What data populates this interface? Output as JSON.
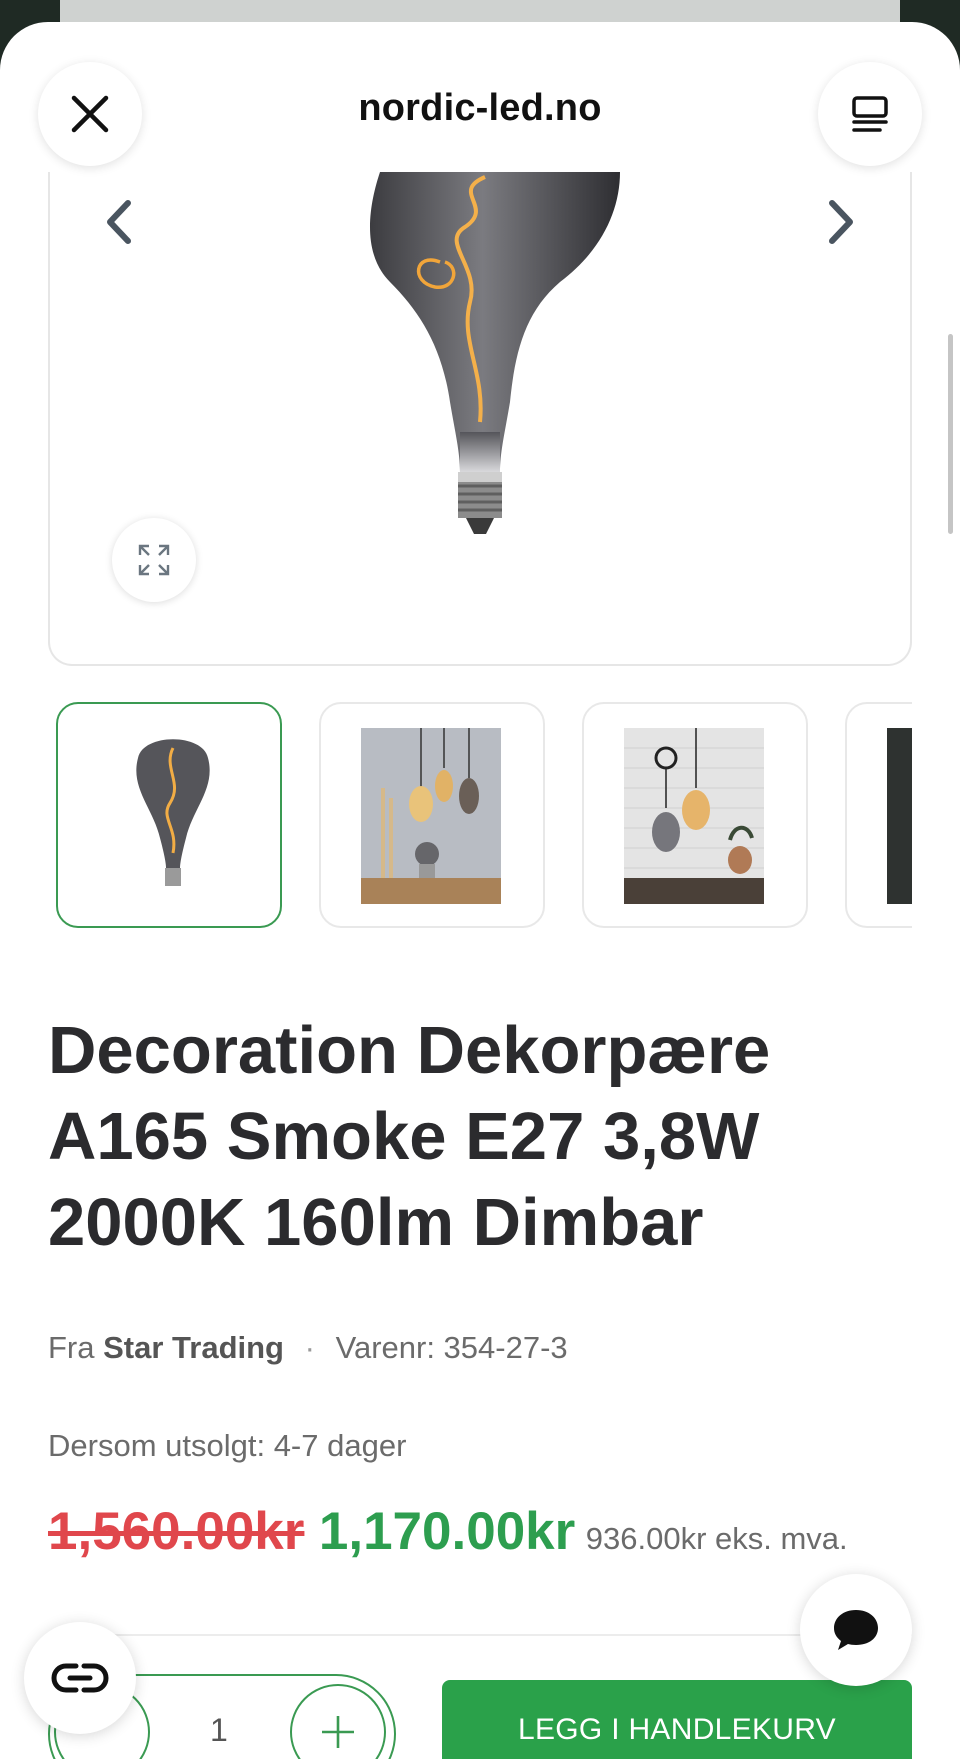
{
  "header": {
    "site": "nordic-led.no",
    "close_icon": "close-icon",
    "menu_icon": "reader-menu-icon"
  },
  "gallery": {
    "prev_icon": "chevron-left-icon",
    "next_icon": "chevron-right-icon",
    "expand_icon": "expand-icon",
    "thumbnails": [
      {
        "name": "bulb-product",
        "active": true
      },
      {
        "name": "pendant-lifestyle",
        "active": false
      },
      {
        "name": "kitchen-lifestyle",
        "active": false
      },
      {
        "name": "dark-photo",
        "active": false
      }
    ]
  },
  "product": {
    "title": "Decoration Dekorpære A165 Smoke E27 3,8W 2000K 160lm Dimbar",
    "from_label": "Fra",
    "brand": "Star Trading",
    "sku": "Varenr: 354-27-3",
    "delivery": "Dersom utsolgt: 4-7 dager",
    "old_price": "1,560.00kr",
    "new_price": "1,170.00kr",
    "ex_vat": "936.00kr eks. mva."
  },
  "cart": {
    "quantity": "1",
    "add_label": "LEGG I HANDLEKURV"
  },
  "colors": {
    "accent": "#2aa14a",
    "sale_red": "#e0474c",
    "price_green": "#2d9e4f"
  }
}
